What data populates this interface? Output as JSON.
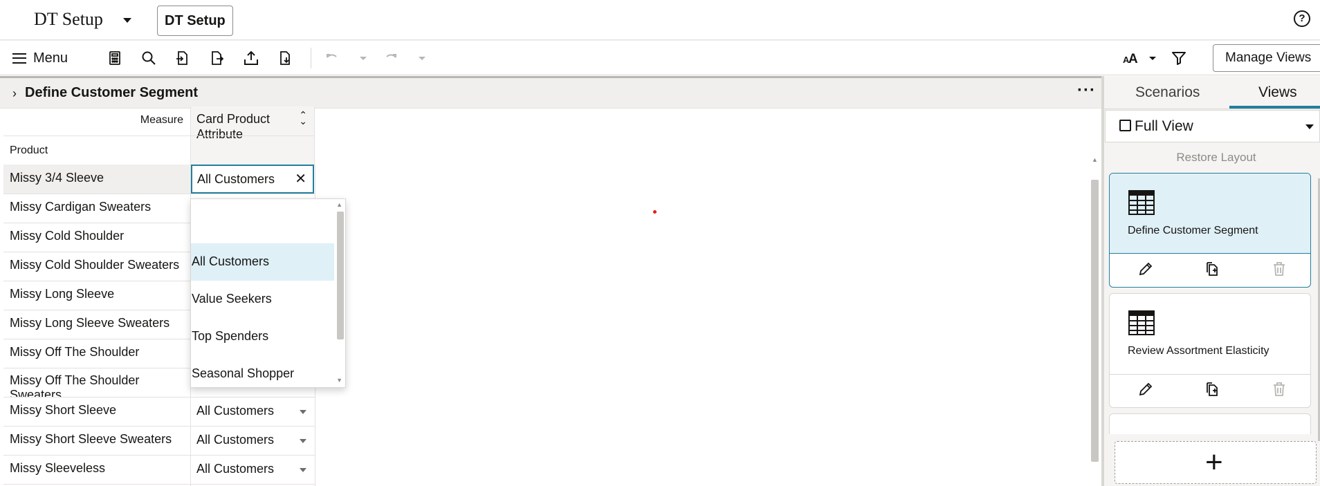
{
  "app": {
    "title": "DT Setup",
    "chip": "DT Setup",
    "help_icon": "help-icon",
    "help_glyph": "?"
  },
  "toolbar": {
    "menu_label": "Menu",
    "icons": [
      "calculator-icon",
      "search-icon",
      "import-icon",
      "export-icon",
      "upload-icon",
      "download-icon",
      "undo-icon",
      "redo-icon",
      "font-size-icon",
      "filter-icon"
    ],
    "manage_views_label": "Manage Views"
  },
  "panel": {
    "title": "Define Customer Segment",
    "more": "···"
  },
  "grid": {
    "measure_header": "Measure",
    "column_header": "Card Product Attribute",
    "row_header": "Product",
    "rows": [
      {
        "product": "Missy 3/4 Sleeve",
        "value": "All Customers"
      },
      {
        "product": "Missy Cardigan Sweaters",
        "value": ""
      },
      {
        "product": "Missy Cold Shoulder",
        "value": ""
      },
      {
        "product": "Missy Cold Shoulder Sweaters",
        "value": ""
      },
      {
        "product": "Missy Long Sleeve",
        "value": ""
      },
      {
        "product": "Missy Long Sleeve Sweaters",
        "value": ""
      },
      {
        "product": "Missy Off The Shoulder",
        "value": ""
      },
      {
        "product": "Missy Off The Shoulder Sweaters",
        "value": ""
      },
      {
        "product": "Missy Short Sleeve",
        "value": "All Customers"
      },
      {
        "product": "Missy Short Sleeve Sweaters",
        "value": "All Customers"
      },
      {
        "product": "Missy Sleeveless",
        "value": "All Customers"
      }
    ]
  },
  "dropdown": {
    "options": [
      "",
      "All Customers",
      "Value Seekers",
      "Top Spenders",
      "Seasonal Shopper"
    ],
    "selected": "All Customers"
  },
  "right_panel": {
    "tabs": [
      "Scenarios",
      "Views"
    ],
    "active_tab": "Views",
    "view_select": "Full View",
    "restore_label": "Restore Layout",
    "cards": [
      {
        "title": "Define Customer Segment",
        "active": true
      },
      {
        "title": "Review Assortment Elasticity",
        "active": false
      }
    ],
    "add_label": "+"
  },
  "colors": {
    "accent": "#227e9e",
    "selected_bg": "#dff0f7",
    "panel_bg": "#f5f4f2",
    "red_dot": "#e0201b"
  }
}
